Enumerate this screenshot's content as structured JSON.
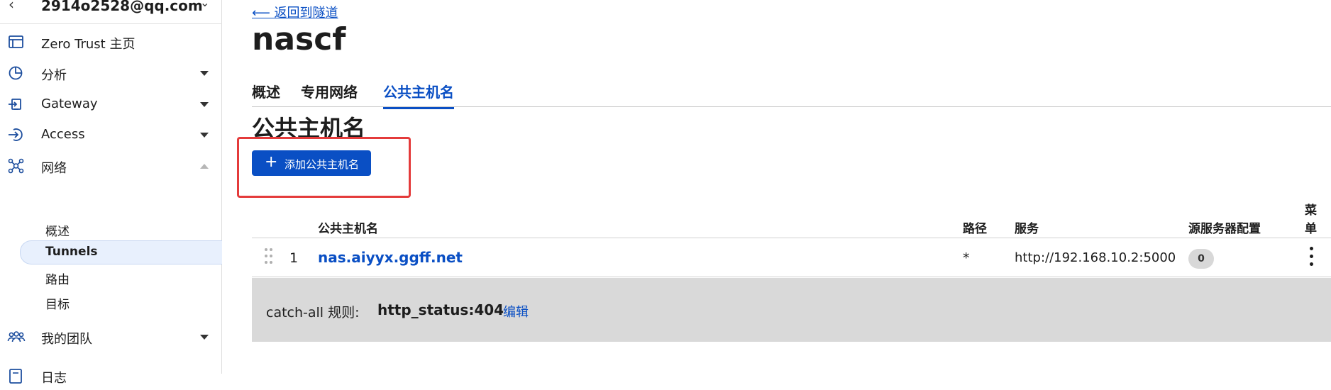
{
  "account": {
    "email": "2914o2528@qq.com",
    "back_glyph": "‹",
    "caret_glyph": "⌄"
  },
  "sidebar": {
    "items": [
      {
        "label": "Zero Trust 主页",
        "icon": "browser-window-icon"
      },
      {
        "label": "分析",
        "icon": "pie-chart-icon"
      },
      {
        "label": "Gateway",
        "icon": "gateway-icon"
      },
      {
        "label": "Access",
        "icon": "access-login-icon"
      },
      {
        "label": "网络",
        "icon": "network-icon"
      },
      {
        "label": "我的团队",
        "icon": "team-icon"
      },
      {
        "label": "日志",
        "icon": "logs-icon"
      }
    ],
    "network_sub": [
      "概述",
      "Tunnels",
      "路由",
      "目标"
    ],
    "active_sub": "Tunnels"
  },
  "main": {
    "back_link": "⟵ 返回到隧道",
    "title": "nascf",
    "tabs": [
      "概述",
      "专用网络",
      "公共主机名"
    ],
    "active_tab": "公共主机名",
    "section_title": "公共主机名",
    "add_button": "添加公共主机名",
    "table": {
      "headers": {
        "hostname": "公共主机名",
        "path": "路径",
        "service": "服务",
        "origin": "源服务器配置",
        "menu_line1": "菜",
        "menu_line2": "单"
      },
      "rows": [
        {
          "index": "1",
          "hostname": "nas.aiyyx.ggff.net",
          "path": "*",
          "service": "http://192.168.10.2:5000",
          "origin_count": "0"
        }
      ]
    },
    "catch_all": {
      "label": "catch-all 规则:",
      "value": "http_status:404",
      "edit": "编辑"
    }
  },
  "colors": {
    "accent": "#0a4fc4",
    "highlight": "#e43b3b",
    "catch_all_bg": "#d9d9d9",
    "active_nav_bg": "#e8f0fd"
  }
}
